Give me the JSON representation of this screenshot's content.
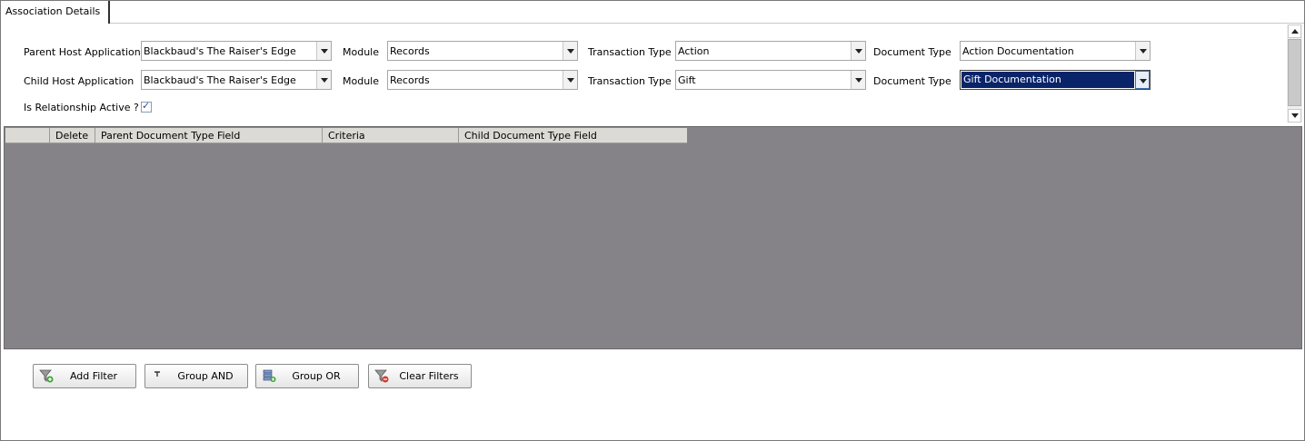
{
  "tabs": [
    {
      "label": "Association Details"
    }
  ],
  "parent": {
    "label": "Parent Host Application",
    "host_application": "Blackbaud's The Raiser's Edge",
    "module_label": "Module",
    "module": "Records",
    "transaction_type_label": "Transaction Type",
    "transaction_type": "Action",
    "document_type_label": "Document Type",
    "document_type": "Action Documentation"
  },
  "child": {
    "label": "Child Host Application",
    "host_application": "Blackbaud's The Raiser's Edge",
    "module_label": "Module",
    "module": "Records",
    "transaction_type_label": "Transaction Type",
    "transaction_type": "Gift",
    "document_type_label": "Document Type",
    "document_type": "Gift Documentation"
  },
  "relationship": {
    "label": "Is Relationship Active ?",
    "active": true,
    "check_glyph": "✓"
  },
  "grid": {
    "columns": [
      "",
      "Delete",
      "Parent Document Type Field",
      "Criteria",
      "Child Document Type Field"
    ],
    "rows": []
  },
  "buttons": {
    "add_filter": "Add Filter",
    "group_and": "Group AND",
    "group_or": "Group OR",
    "clear_filters": "Clear Filters"
  },
  "colors": {
    "grid_background": "#858387",
    "selection": "#0a246a",
    "header_background": "#dcdad5"
  },
  "icons": {
    "add_filter": "filter-add-icon",
    "group_and": "group-and-icon",
    "group_or": "group-or-icon",
    "clear_filters": "filter-clear-icon"
  }
}
